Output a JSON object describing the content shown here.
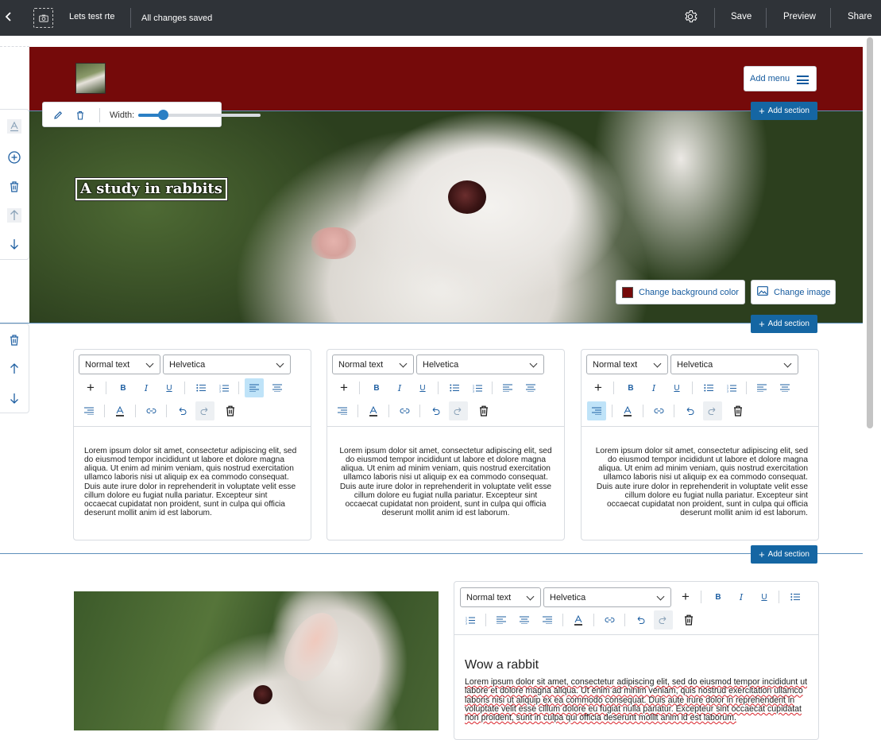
{
  "topbar": {
    "title": "Lets test rte",
    "status": "All changes saved",
    "save_label": "Save",
    "preview_label": "Preview",
    "share_label": "Share"
  },
  "header": {
    "add_menu_label": "Add menu",
    "background_color": "#750a0a"
  },
  "add_section_label": "Add section",
  "hero": {
    "title": "A study in rabbits",
    "change_bg_label": "Change background color",
    "change_image_label": "Change image"
  },
  "image_toolbar": {
    "width_label": "Width:",
    "width_value": 0.2
  },
  "editor_defaults": {
    "style": "Normal text",
    "font": "Helvetica"
  },
  "lorem": "Lorem ipsum dolor sit amet, consectetur adipiscing elit, sed do eiusmod tempor incididunt ut labore et dolore magna aliqua. Ut enim ad minim veniam, quis nostrud exercitation ullamco laboris nisi ut aliquip ex ea commodo consequat. Duis aute irure dolor in reprehenderit in voluptate velit esse cillum dolore eu fugiat nulla pariatur. Excepteur sint occaecat cupidatat non proident, sunt in culpa qui officia deserunt mollit anim id est laborum.",
  "columns": [
    {
      "align": "left"
    },
    {
      "align": "center"
    },
    {
      "align": "right"
    }
  ],
  "section2": {
    "heading": "Wow a rabbit",
    "paragraph": "Lorem ipsum dolor sit amet, consectetur adipiscing elit, sed do eiusmod tempor incididunt ut labore et dolore magna aliqua. Ut enim ad minim veniam, quis nostrud exercitation ullamco laboris nisi ut aliquip ex ea commodo consequat. Duis aute irure dolor in reprehenderit in voluptate velit esse cillum dolore eu fugiat nulla pariatur. Excepteur sint occaecat cupidatat non proident, sunt in culpa qui officia deserunt mollit anim id est laborum."
  },
  "colors": {
    "accent": "#1566a3",
    "topbar": "#2f3338",
    "active_button": "#bfe3f8"
  }
}
